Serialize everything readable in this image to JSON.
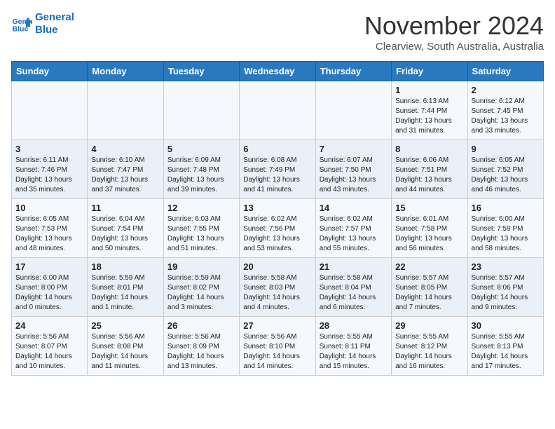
{
  "header": {
    "logo_line1": "General",
    "logo_line2": "Blue",
    "month": "November 2024",
    "location": "Clearview, South Australia, Australia"
  },
  "days_of_week": [
    "Sunday",
    "Monday",
    "Tuesday",
    "Wednesday",
    "Thursday",
    "Friday",
    "Saturday"
  ],
  "weeks": [
    [
      {
        "day": "",
        "content": ""
      },
      {
        "day": "",
        "content": ""
      },
      {
        "day": "",
        "content": ""
      },
      {
        "day": "",
        "content": ""
      },
      {
        "day": "",
        "content": ""
      },
      {
        "day": "1",
        "content": "Sunrise: 6:13 AM\nSunset: 7:44 PM\nDaylight: 13 hours\nand 31 minutes."
      },
      {
        "day": "2",
        "content": "Sunrise: 6:12 AM\nSunset: 7:45 PM\nDaylight: 13 hours\nand 33 minutes."
      }
    ],
    [
      {
        "day": "3",
        "content": "Sunrise: 6:11 AM\nSunset: 7:46 PM\nDaylight: 13 hours\nand 35 minutes."
      },
      {
        "day": "4",
        "content": "Sunrise: 6:10 AM\nSunset: 7:47 PM\nDaylight: 13 hours\nand 37 minutes."
      },
      {
        "day": "5",
        "content": "Sunrise: 6:09 AM\nSunset: 7:48 PM\nDaylight: 13 hours\nand 39 minutes."
      },
      {
        "day": "6",
        "content": "Sunrise: 6:08 AM\nSunset: 7:49 PM\nDaylight: 13 hours\nand 41 minutes."
      },
      {
        "day": "7",
        "content": "Sunrise: 6:07 AM\nSunset: 7:50 PM\nDaylight: 13 hours\nand 43 minutes."
      },
      {
        "day": "8",
        "content": "Sunrise: 6:06 AM\nSunset: 7:51 PM\nDaylight: 13 hours\nand 44 minutes."
      },
      {
        "day": "9",
        "content": "Sunrise: 6:05 AM\nSunset: 7:52 PM\nDaylight: 13 hours\nand 46 minutes."
      }
    ],
    [
      {
        "day": "10",
        "content": "Sunrise: 6:05 AM\nSunset: 7:53 PM\nDaylight: 13 hours\nand 48 minutes."
      },
      {
        "day": "11",
        "content": "Sunrise: 6:04 AM\nSunset: 7:54 PM\nDaylight: 13 hours\nand 50 minutes."
      },
      {
        "day": "12",
        "content": "Sunrise: 6:03 AM\nSunset: 7:55 PM\nDaylight: 13 hours\nand 51 minutes."
      },
      {
        "day": "13",
        "content": "Sunrise: 6:02 AM\nSunset: 7:56 PM\nDaylight: 13 hours\nand 53 minutes."
      },
      {
        "day": "14",
        "content": "Sunrise: 6:02 AM\nSunset: 7:57 PM\nDaylight: 13 hours\nand 55 minutes."
      },
      {
        "day": "15",
        "content": "Sunrise: 6:01 AM\nSunset: 7:58 PM\nDaylight: 13 hours\nand 56 minutes."
      },
      {
        "day": "16",
        "content": "Sunrise: 6:00 AM\nSunset: 7:59 PM\nDaylight: 13 hours\nand 58 minutes."
      }
    ],
    [
      {
        "day": "17",
        "content": "Sunrise: 6:00 AM\nSunset: 8:00 PM\nDaylight: 14 hours\nand 0 minutes."
      },
      {
        "day": "18",
        "content": "Sunrise: 5:59 AM\nSunset: 8:01 PM\nDaylight: 14 hours\nand 1 minute."
      },
      {
        "day": "19",
        "content": "Sunrise: 5:59 AM\nSunset: 8:02 PM\nDaylight: 14 hours\nand 3 minutes."
      },
      {
        "day": "20",
        "content": "Sunrise: 5:58 AM\nSunset: 8:03 PM\nDaylight: 14 hours\nand 4 minutes."
      },
      {
        "day": "21",
        "content": "Sunrise: 5:58 AM\nSunset: 8:04 PM\nDaylight: 14 hours\nand 6 minutes."
      },
      {
        "day": "22",
        "content": "Sunrise: 5:57 AM\nSunset: 8:05 PM\nDaylight: 14 hours\nand 7 minutes."
      },
      {
        "day": "23",
        "content": "Sunrise: 5:57 AM\nSunset: 8:06 PM\nDaylight: 14 hours\nand 9 minutes."
      }
    ],
    [
      {
        "day": "24",
        "content": "Sunrise: 5:56 AM\nSunset: 8:07 PM\nDaylight: 14 hours\nand 10 minutes."
      },
      {
        "day": "25",
        "content": "Sunrise: 5:56 AM\nSunset: 8:08 PM\nDaylight: 14 hours\nand 11 minutes."
      },
      {
        "day": "26",
        "content": "Sunrise: 5:56 AM\nSunset: 8:09 PM\nDaylight: 14 hours\nand 13 minutes."
      },
      {
        "day": "27",
        "content": "Sunrise: 5:56 AM\nSunset: 8:10 PM\nDaylight: 14 hours\nand 14 minutes."
      },
      {
        "day": "28",
        "content": "Sunrise: 5:55 AM\nSunset: 8:11 PM\nDaylight: 14 hours\nand 15 minutes."
      },
      {
        "day": "29",
        "content": "Sunrise: 5:55 AM\nSunset: 8:12 PM\nDaylight: 14 hours\nand 16 minutes."
      },
      {
        "day": "30",
        "content": "Sunrise: 5:55 AM\nSunset: 8:13 PM\nDaylight: 14 hours\nand 17 minutes."
      }
    ]
  ]
}
